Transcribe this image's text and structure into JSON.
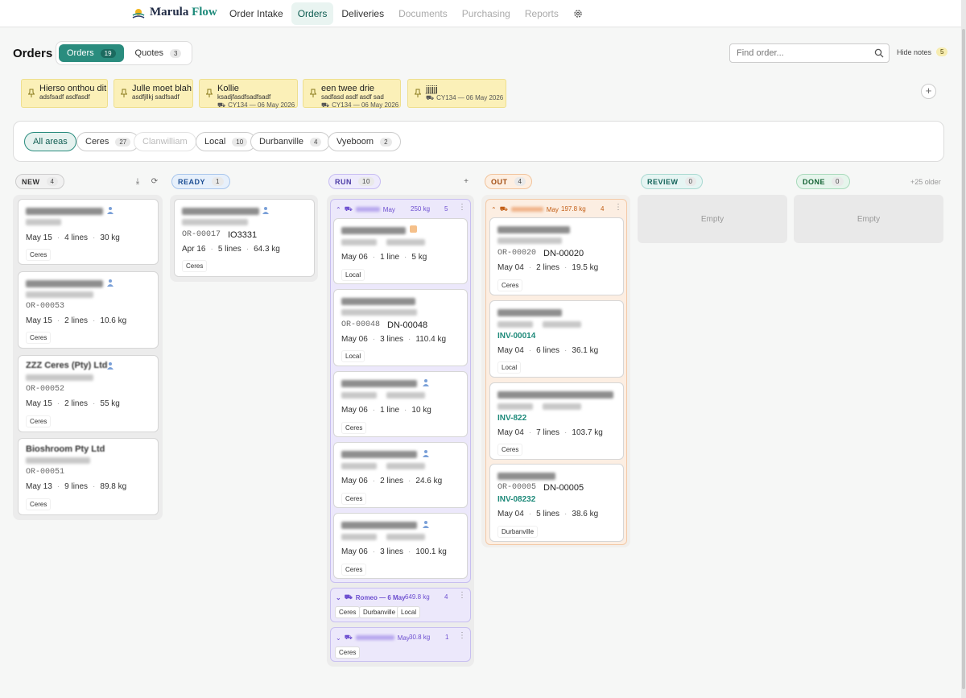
{
  "app": {
    "name_1": "Marula",
    "name_2": "Flow"
  },
  "nav": {
    "items": [
      "Order Intake",
      "Orders",
      "Deliveries",
      "Documents",
      "Purchasing",
      "Reports"
    ],
    "active": "Orders"
  },
  "page": {
    "title": "Orders"
  },
  "tabs": [
    {
      "label": "Orders",
      "count": "19"
    },
    {
      "label": "Quotes",
      "count": "3"
    }
  ],
  "search": {
    "placeholder": "Find order..."
  },
  "hide_notes": {
    "label": "Hide notes",
    "count": "5"
  },
  "notes": [
    {
      "title": "Hierso onthou dit",
      "body": "adsfsadf asdfasdf"
    },
    {
      "title": "Julle moet blah",
      "body": "asdfjllkj sadfsadf"
    },
    {
      "title": "Kollie",
      "body": "ksadjfasdfsadfsadf",
      "link": "CY134 — 06 May 2026"
    },
    {
      "title": "een twee drie",
      "body": "sadfasd asdf asdf sad",
      "link": "CY134 — 06 May 2026"
    },
    {
      "title": "jjjjjj",
      "body": "",
      "link": "CY134 — 06 May 2026"
    }
  ],
  "areas": [
    {
      "label": "All areas"
    },
    {
      "label": "Ceres",
      "count": "27"
    },
    {
      "label": "Clanwilliam"
    },
    {
      "label": "Local",
      "count": "10"
    },
    {
      "label": "Durbanville",
      "count": "4"
    },
    {
      "label": "Vyeboom",
      "count": "2"
    }
  ],
  "columns": {
    "new": {
      "label": "NEW",
      "count": "4"
    },
    "ready": {
      "label": "READY",
      "count": "1"
    },
    "run": {
      "label": "RUN",
      "count": "10"
    },
    "out": {
      "label": "OUT",
      "count": "4"
    },
    "review": {
      "label": "REVIEW",
      "count": "0",
      "empty": "Empty"
    },
    "done": {
      "label": "DONE",
      "count": "0",
      "empty": "Empty"
    },
    "older": "+25 older"
  },
  "new_cards": [
    {
      "date": "May 15",
      "lines": "4 lines",
      "weight": "30 kg",
      "area": "Ceres"
    },
    {
      "code": "OR-00053",
      "date": "May 15",
      "lines": "2 lines",
      "weight": "10.6 kg",
      "area": "Ceres"
    },
    {
      "title": "ZZZ Ceres (Pty) Ltd",
      "code": "OR-00052",
      "date": "May 15",
      "lines": "2 lines",
      "weight": "55 kg",
      "area": "Ceres"
    },
    {
      "title": "Bioshroom Pty Ltd",
      "code": "OR-00051",
      "date": "May 13",
      "lines": "9 lines",
      "weight": "89.8 kg",
      "area": "Ceres"
    }
  ],
  "ready_cards": [
    {
      "code": "OR-00017",
      "ref": "IO3331",
      "date": "Apr 16",
      "lines": "5 lines",
      "weight": "64.3 kg",
      "area": "Ceres"
    }
  ],
  "run_group1": {
    "label": "May",
    "weight": "250 kg",
    "count": "5"
  },
  "run_cards": [
    {
      "date": "May 06",
      "lines": "1 line",
      "weight": "5 kg",
      "area": "Local"
    },
    {
      "code": "OR-00048",
      "ref": "DN-00048",
      "date": "May 06",
      "lines": "3 lines",
      "weight": "110.4 kg",
      "area": "Local"
    },
    {
      "date": "May 06",
      "lines": "1 line",
      "weight": "10 kg",
      "area": "Ceres"
    },
    {
      "date": "May 06",
      "lines": "2 lines",
      "weight": "24.6 kg",
      "area": "Ceres"
    },
    {
      "date": "May 06",
      "lines": "3 lines",
      "weight": "100.1 kg",
      "area": "Ceres"
    }
  ],
  "run_group2": {
    "label": "Romeo — 6 May",
    "weight": "649.8 kg",
    "count": "4",
    "tags": [
      "Ceres",
      "Durbanville",
      "Local"
    ]
  },
  "run_group3": {
    "label": "May",
    "weight": "30.8 kg",
    "count": "1",
    "tags": [
      "Ceres"
    ]
  },
  "out_group": {
    "label": "May",
    "weight": "197.8 kg",
    "count": "4"
  },
  "out_cards": [
    {
      "code": "OR-00020",
      "ref": "DN-00020",
      "date": "May 04",
      "lines": "2 lines",
      "weight": "19.5 kg",
      "area": "Ceres"
    },
    {
      "inv": "INV-00014",
      "date": "May 04",
      "lines": "6 lines",
      "weight": "36.1 kg",
      "area": "Local"
    },
    {
      "inv": "INV-822",
      "date": "May 04",
      "lines": "7 lines",
      "weight": "103.7 kg",
      "area": "Ceres"
    },
    {
      "code": "OR-00005",
      "ref": "DN-00005",
      "inv": "INV-08232",
      "date": "May 04",
      "lines": "5 lines",
      "weight": "38.6 kg",
      "area": "Durbanville"
    }
  ],
  "colors": {
    "accent": "#2a8c7e",
    "note": "#fbf0b8",
    "run": "#6d4fd0",
    "out": "#c35e15"
  }
}
